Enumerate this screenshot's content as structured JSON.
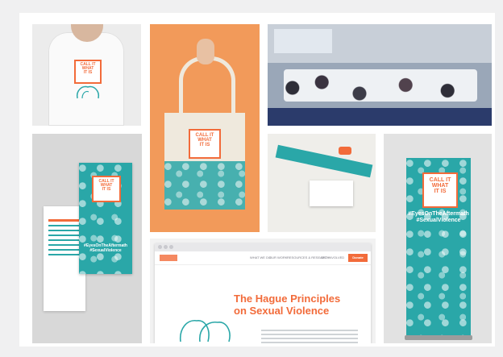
{
  "collage": {
    "description_tiles": [
      "tshirt",
      "tote-bag",
      "meeting-room",
      "lanyard",
      "leaflet",
      "website",
      "rollup-banner"
    ]
  },
  "badge": {
    "line1": "CALL IT",
    "line2": "WHAT",
    "line3": "IT IS"
  },
  "hashtags": {
    "a": "#EyesOnTheAftermath",
    "b": "#SexualViolence"
  },
  "website": {
    "headline_1": "The Hague Principles",
    "headline_2": "on Sexual Violence",
    "nav": [
      "WHAT WE DO",
      "OUR WORK",
      "RESOURCES & RESEARCH",
      "GET INVOLVED",
      "Donate"
    ]
  },
  "colors": {
    "teal": "#2aa7a8",
    "orange": "#f26b3a",
    "tote_bg": "#f29a5a"
  }
}
